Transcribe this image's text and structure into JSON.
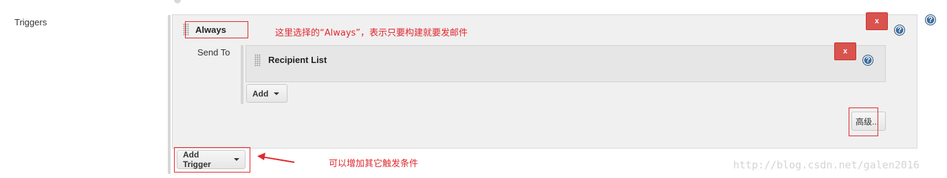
{
  "field_label": "Triggers",
  "trigger": {
    "name": "Always",
    "delete_label": "x",
    "help_symbol": "?",
    "send_to_label": "Send To",
    "recipient": {
      "name": "Recipient List",
      "delete_label": "x",
      "help_symbol": "?"
    },
    "add_button_label": "Add",
    "advanced_button_label": "高级..."
  },
  "add_trigger_label": "Add Trigger",
  "page_help_symbol": "?",
  "annotations": {
    "always_note": "这里选择的“Always”，表示只要构建就要发邮件",
    "add_trigger_note": "可以增加其它触发条件"
  },
  "watermark": "http://blog.csdn.net/galen2016",
  "colors": {
    "annotation_red": "#e0282e",
    "delete_red": "#d9534f",
    "help_blue": "#3e6d9c",
    "panel_gray": "#f0f0f0"
  }
}
